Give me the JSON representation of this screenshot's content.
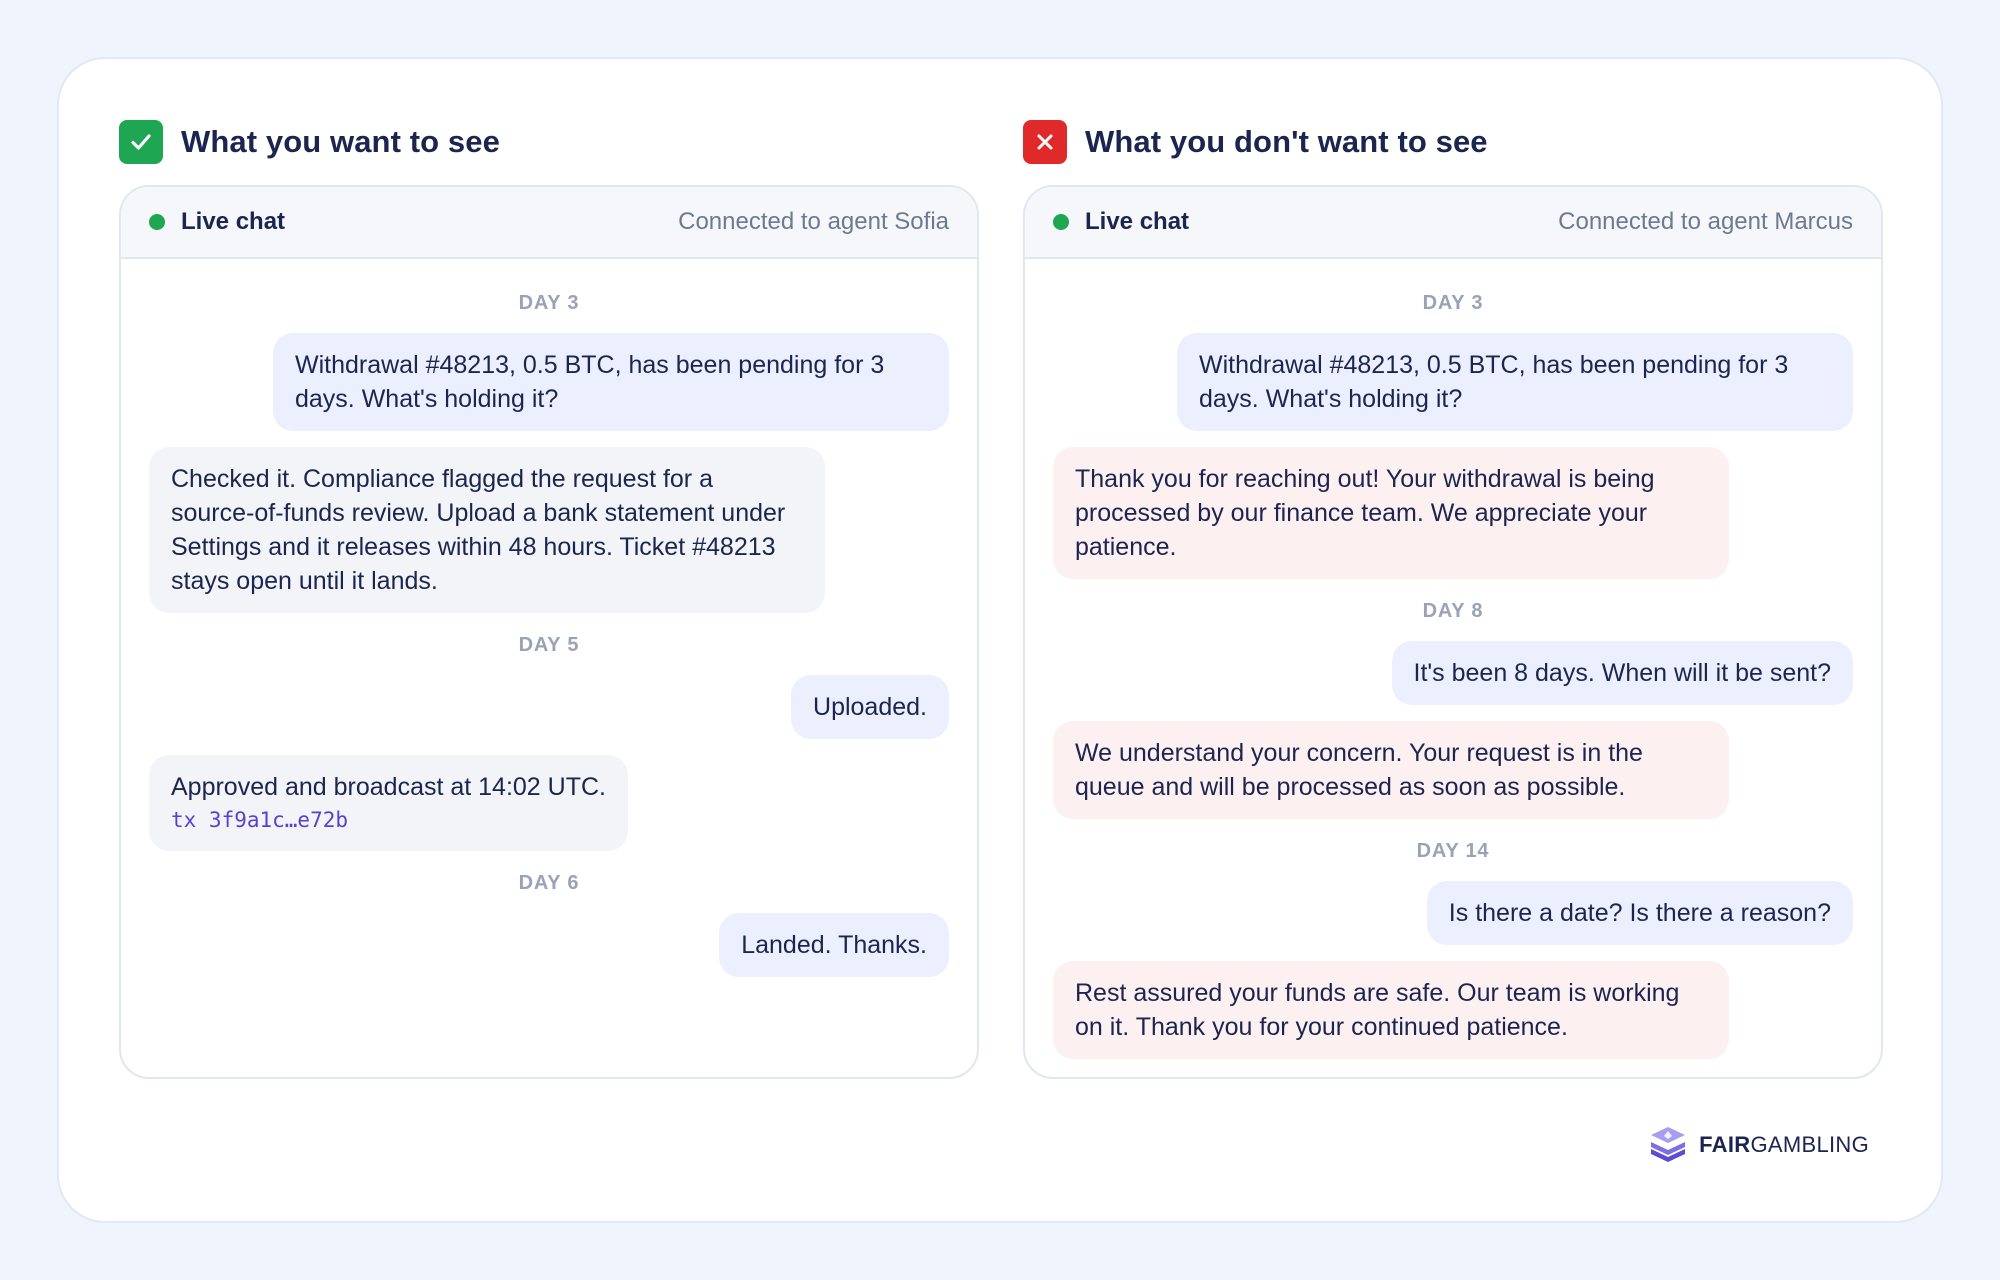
{
  "good": {
    "title": "What you want to see",
    "badge_icon": "check-icon",
    "chat": {
      "live_label": "Live chat",
      "agent": "Connected to agent Sofia",
      "messages": [
        {
          "kind": "day",
          "text": "DAY 3"
        },
        {
          "kind": "user",
          "text": "Withdrawal #48213, 0.5 BTC, has been pending for 3 days. What's holding it?"
        },
        {
          "kind": "agent",
          "text": "Checked it. Compliance flagged the request for a source-of-funds review. Upload a bank statement under Settings and it releases within 48 hours. Ticket #48213 stays open until it lands."
        },
        {
          "kind": "day",
          "text": "DAY 5"
        },
        {
          "kind": "user",
          "text": "Uploaded."
        },
        {
          "kind": "agent",
          "text": "Approved and broadcast at 14:02 UTC.",
          "tx": "tx 3f9a1c…e72b"
        },
        {
          "kind": "day",
          "text": "DAY 6"
        },
        {
          "kind": "user",
          "text": "Landed. Thanks."
        }
      ]
    }
  },
  "bad": {
    "title": "What you don't want to see",
    "badge_icon": "x-icon",
    "chat": {
      "live_label": "Live chat",
      "agent": "Connected to agent Marcus",
      "messages": [
        {
          "kind": "day",
          "text": "DAY 3"
        },
        {
          "kind": "user",
          "text": "Withdrawal #48213, 0.5 BTC, has been pending for 3 days. What's holding it?"
        },
        {
          "kind": "agent",
          "text": "Thank you for reaching out! Your withdrawal is being processed by our finance team. We appreciate your patience."
        },
        {
          "kind": "day",
          "text": "DAY 8"
        },
        {
          "kind": "user",
          "text": "It's been 8 days. When will it be sent?"
        },
        {
          "kind": "agent",
          "text": "We understand your concern. Your request is in the queue and will be processed as soon as possible."
        },
        {
          "kind": "day",
          "text": "DAY 14"
        },
        {
          "kind": "user",
          "text": "Is there a date? Is there a reason?"
        },
        {
          "kind": "agent",
          "text": "Rest assured your funds are safe. Our team is working on it. Thank you for your continued patience."
        }
      ]
    }
  },
  "logo": {
    "bold": "FAIR",
    "light": "GAMBLING",
    "icon": "fairgambling-logo-icon"
  },
  "colors": {
    "good": "#1fa653",
    "bad": "#e02a2a",
    "user_bubble": "#eceffd",
    "agent_bubble": "#f2f4f8",
    "agent_bubble_bad": "#fdf0f1",
    "tx_link": "#5a3fd0"
  }
}
